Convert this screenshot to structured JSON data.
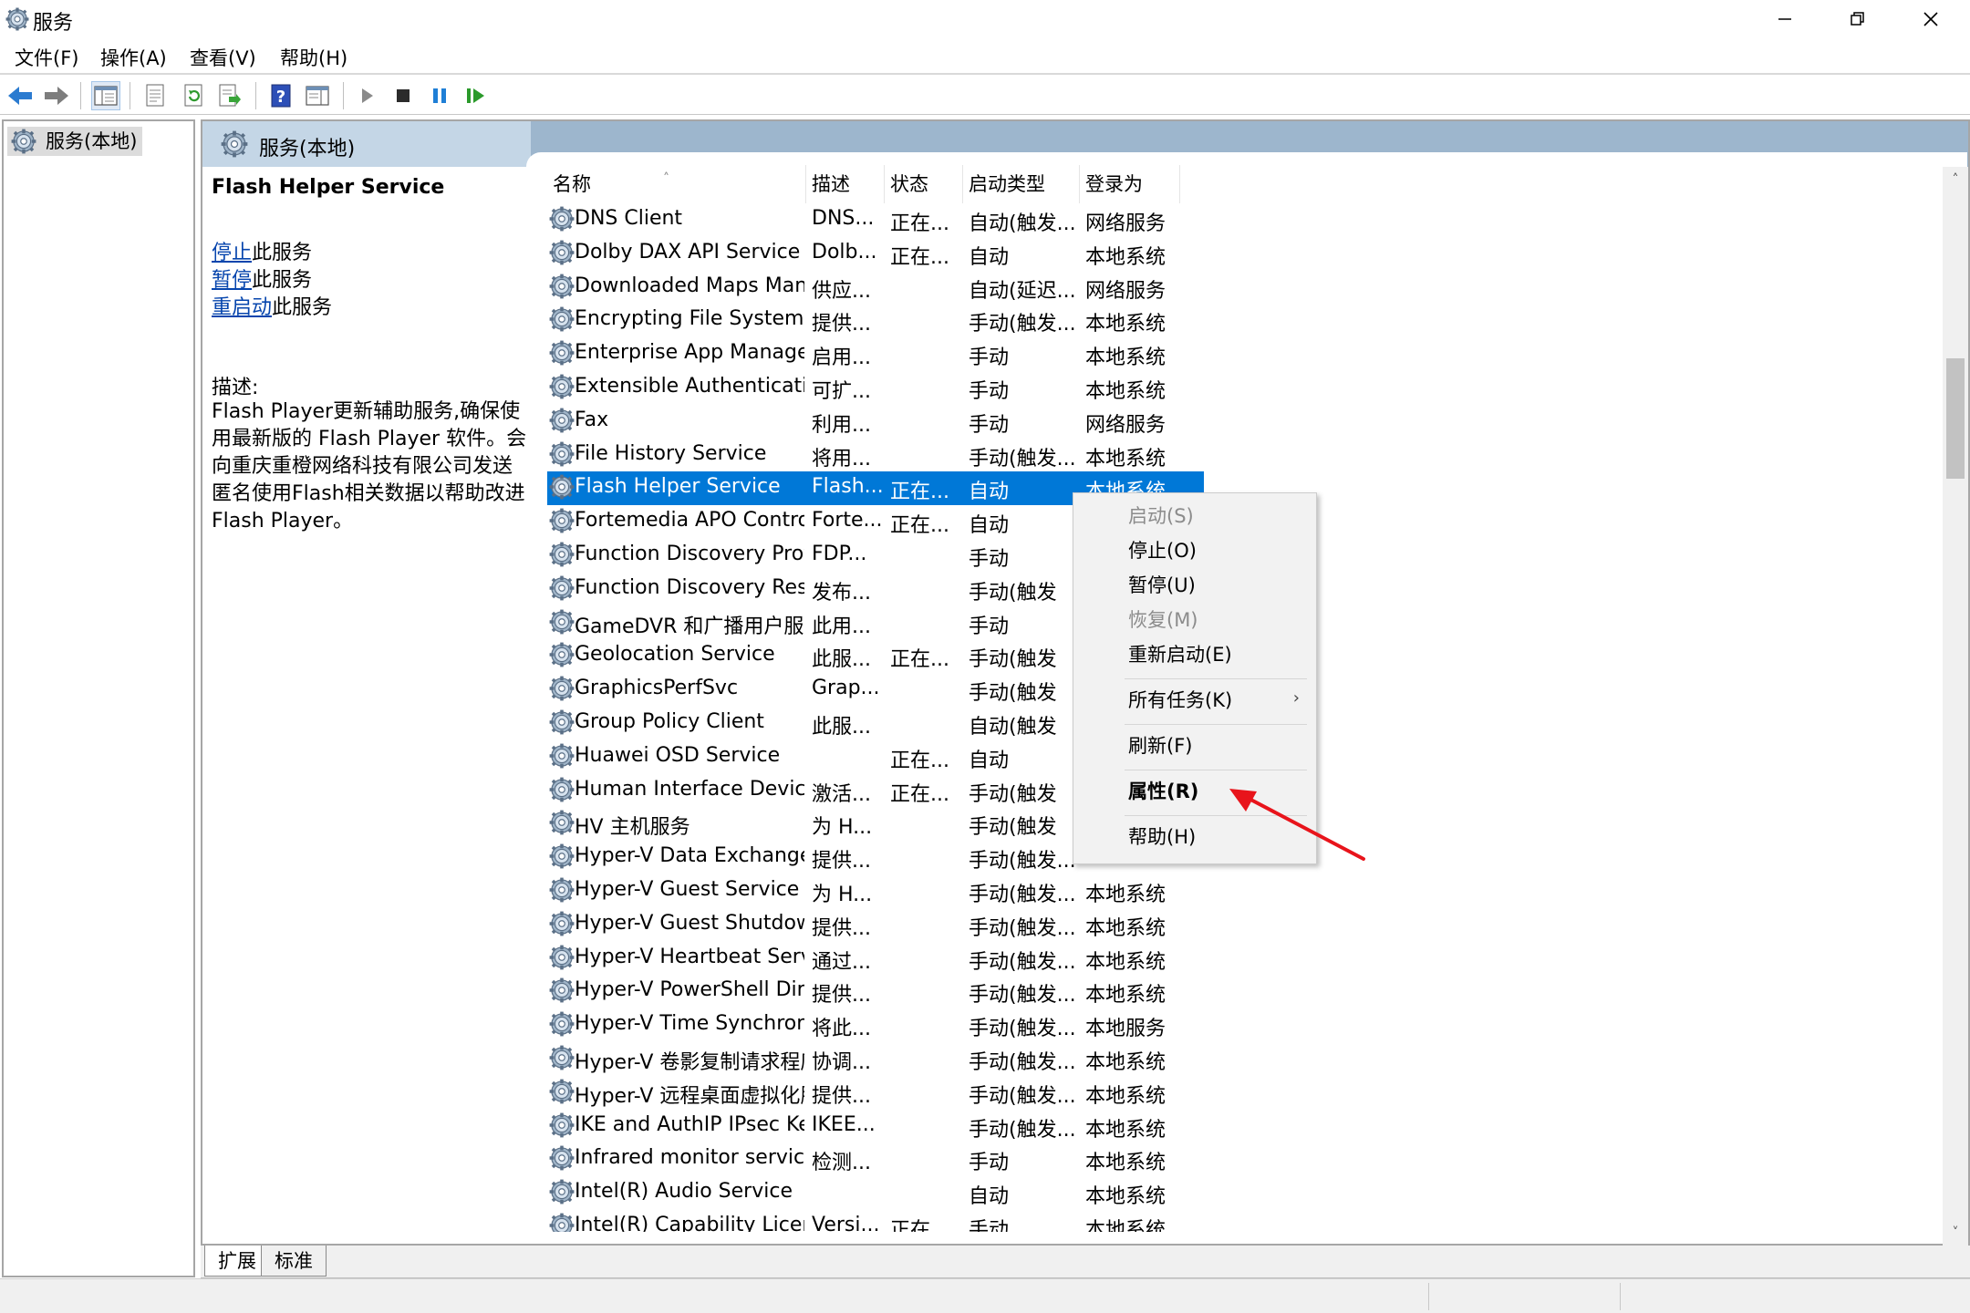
{
  "window": {
    "title": "服务",
    "icon": "gear-icon"
  },
  "menu": [
    "文件(F)",
    "操作(A)",
    "查看(V)",
    "帮助(H)"
  ],
  "tree": {
    "root_label": "服务(本地)"
  },
  "pane": {
    "header_title": "服务(本地)"
  },
  "details": {
    "service_title": "Flash Helper Service",
    "action_stop_link": "停止",
    "action_stop_suffix": "此服务",
    "action_pause_link": "暂停",
    "action_pause_suffix": "此服务",
    "action_restart_link": "重启动",
    "action_restart_suffix": "此服务",
    "description_label": "描述:",
    "description_text": "Flash Player更新辅助服务,确保使用最新版的 Flash Player 软件。会向重庆重橙网络科技有限公司发送匿名使用Flash相关数据以帮助改进 Flash Player。"
  },
  "columns": {
    "name": "名称",
    "desc": "描述",
    "status": "状态",
    "startup": "启动类型",
    "logon": "登录为"
  },
  "rows": [
    {
      "name": "DNS Client",
      "desc": "DNS...",
      "status": "正在...",
      "startup": "自动(触发...",
      "logon": "网络服务"
    },
    {
      "name": "Dolby DAX API Service",
      "desc": "Dolb...",
      "status": "正在...",
      "startup": "自动",
      "logon": "本地系统"
    },
    {
      "name": "Downloaded Maps Manager",
      "desc": "供应...",
      "status": "",
      "startup": "自动(延迟...",
      "logon": "网络服务"
    },
    {
      "name": "Encrypting File System (EFS)",
      "desc": "提供...",
      "status": "",
      "startup": "手动(触发...",
      "logon": "本地系统"
    },
    {
      "name": "Enterprise App Manageme...",
      "desc": "启用...",
      "status": "",
      "startup": "手动",
      "logon": "本地系统"
    },
    {
      "name": "Extensible Authentication ...",
      "desc": "可扩...",
      "status": "",
      "startup": "手动",
      "logon": "本地系统"
    },
    {
      "name": "Fax",
      "desc": "利用...",
      "status": "",
      "startup": "手动",
      "logon": "网络服务"
    },
    {
      "name": "File History Service",
      "desc": "将用...",
      "status": "",
      "startup": "手动(触发...",
      "logon": "本地系统"
    },
    {
      "name": "Flash Helper Service",
      "desc": "Flash...",
      "status": "正在...",
      "startup": "自动",
      "logon": "本地系统"
    },
    {
      "name": "Fortemedia APO Control S...",
      "desc": "Forte...",
      "status": "正在...",
      "startup": "自动",
      "logon": ""
    },
    {
      "name": "Function Discovery Provide...",
      "desc": "FDP...",
      "status": "",
      "startup": "手动",
      "logon": ""
    },
    {
      "name": "Function Discovery Resour...",
      "desc": "发布...",
      "status": "",
      "startup": "手动(触发",
      "logon": ""
    },
    {
      "name": "GameDVR 和广播用户服务...",
      "desc": "此用...",
      "status": "",
      "startup": "手动",
      "logon": ""
    },
    {
      "name": "Geolocation Service",
      "desc": "此服...",
      "status": "正在...",
      "startup": "手动(触发",
      "logon": ""
    },
    {
      "name": "GraphicsPerfSvc",
      "desc": "Grap...",
      "status": "",
      "startup": "手动(触发",
      "logon": ""
    },
    {
      "name": "Group Policy Client",
      "desc": "此服...",
      "status": "",
      "startup": "自动(触发",
      "logon": ""
    },
    {
      "name": "Huawei OSD Service",
      "desc": "",
      "status": "正在...",
      "startup": "自动",
      "logon": ""
    },
    {
      "name": "Human Interface Device S...",
      "desc": "激活...",
      "status": "正在...",
      "startup": "手动(触发",
      "logon": ""
    },
    {
      "name": "HV 主机服务",
      "desc": "为 H...",
      "status": "",
      "startup": "手动(触发",
      "logon": ""
    },
    {
      "name": "Hyper-V Data Exchange Se...",
      "desc": "提供...",
      "status": "",
      "startup": "手动(触发...",
      "logon": ""
    },
    {
      "name": "Hyper-V Guest Service Int...",
      "desc": "为 H...",
      "status": "",
      "startup": "手动(触发...",
      "logon": "本地系统"
    },
    {
      "name": "Hyper-V Guest Shutdown ...",
      "desc": "提供...",
      "status": "",
      "startup": "手动(触发...",
      "logon": "本地系统"
    },
    {
      "name": "Hyper-V Heartbeat Service",
      "desc": "通过...",
      "status": "",
      "startup": "手动(触发...",
      "logon": "本地系统"
    },
    {
      "name": "Hyper-V PowerShell Direct...",
      "desc": "提供...",
      "status": "",
      "startup": "手动(触发...",
      "logon": "本地系统"
    },
    {
      "name": "Hyper-V Time Synchroniza...",
      "desc": "将此...",
      "status": "",
      "startup": "手动(触发...",
      "logon": "本地服务"
    },
    {
      "name": "Hyper-V 卷影复制请求程序",
      "desc": "协调...",
      "status": "",
      "startup": "手动(触发...",
      "logon": "本地系统"
    },
    {
      "name": "Hyper-V 远程桌面虚拟化服...",
      "desc": "提供...",
      "status": "",
      "startup": "手动(触发...",
      "logon": "本地系统"
    },
    {
      "name": "IKE and AuthIP IPsec Keyin...",
      "desc": "IKEE...",
      "status": "",
      "startup": "手动(触发...",
      "logon": "本地系统"
    },
    {
      "name": "Infrared monitor service",
      "desc": "检测...",
      "status": "",
      "startup": "手动",
      "logon": "本地系统"
    },
    {
      "name": "Intel(R) Audio Service",
      "desc": "",
      "status": "",
      "startup": "自动",
      "logon": "本地系统"
    },
    {
      "name": "Intel(R) Capability Licensin...",
      "desc": "Versi...",
      "status": "正在...",
      "startup": "手动",
      "logon": "本地系统"
    }
  ],
  "selected_row_index": 8,
  "context_menu": {
    "items": [
      {
        "label": "启动(S)",
        "disabled": true
      },
      {
        "label": "停止(O)",
        "disabled": false
      },
      {
        "label": "暂停(U)",
        "disabled": false
      },
      {
        "label": "恢复(M)",
        "disabled": true
      },
      {
        "label": "重新启动(E)",
        "disabled": false
      },
      {
        "label": "所有任务(K)",
        "disabled": false,
        "submenu": true
      },
      {
        "label": "刷新(F)",
        "disabled": false
      },
      {
        "label": "属性(R)",
        "disabled": false,
        "bold": true
      },
      {
        "label": "帮助(H)",
        "disabled": false
      }
    ],
    "submenu_glyph": "›"
  },
  "bottom_tabs": [
    "扩展",
    "标准"
  ],
  "colors": {
    "selection": "#0078d7",
    "link": "#0645ad",
    "annotation_arrow": "#e8141b",
    "pane_header": "#9db6cd"
  }
}
